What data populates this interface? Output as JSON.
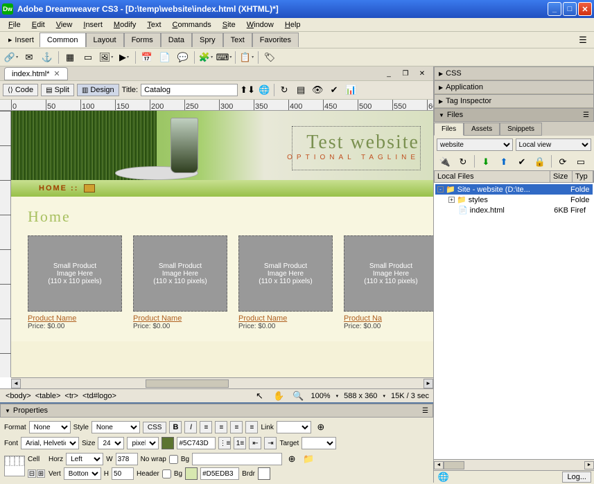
{
  "window": {
    "title": "Adobe Dreamweaver CS3 - [D:\\temp\\website\\index.html (XHTML)*]",
    "app_icon": "Dw"
  },
  "menu": [
    "File",
    "Edit",
    "View",
    "Insert",
    "Modify",
    "Text",
    "Commands",
    "Site",
    "Window",
    "Help"
  ],
  "insert_bar": {
    "label": "Insert",
    "tabs": [
      "Common",
      "Layout",
      "Forms",
      "Data",
      "Spry",
      "Text",
      "Favorites"
    ],
    "active": "Common"
  },
  "doc_tab": {
    "name": "index.html*"
  },
  "view_toolbar": {
    "code": "Code",
    "split": "Split",
    "design": "Design",
    "title_label": "Title:",
    "title_value": "Catalog"
  },
  "canvas": {
    "site_title": "Test website",
    "tagline": "OPTIONAL TAGLINE",
    "nav_home": "HOME ::",
    "page_heading": "Home",
    "placeholder_text": "Small Product\nImage Here\n(110 x 110 pixels)",
    "products": [
      {
        "name": "Product Name",
        "price": "Price: $0.00"
      },
      {
        "name": "Product Name",
        "price": "Price: $0.00"
      },
      {
        "name": "Product Name",
        "price": "Price: $0.00"
      },
      {
        "name": "Product Na",
        "price": "Price: $0.00"
      }
    ]
  },
  "status": {
    "tags": [
      "<body>",
      "<table>",
      "<tr>",
      "<td#logo>"
    ],
    "zoom": "100%",
    "dims": "588 x 360",
    "kb": "15K / 3 sec"
  },
  "properties": {
    "header": "Properties",
    "format_label": "Format",
    "format_value": "None",
    "style_label": "Style",
    "style_value": "None",
    "css_btn": "CSS",
    "link_label": "Link",
    "font_label": "Font",
    "font_value": "Arial, Helvetica",
    "size_label": "Size",
    "size_value": "24",
    "size_unit": "pixels",
    "color_value": "#5C743D",
    "target_label": "Target",
    "cell_label": "Cell",
    "horz_label": "Horz",
    "horz_value": "Left",
    "w_label": "W",
    "w_value": "378",
    "nowrap_label": "No wrap",
    "bg_label": "Bg",
    "vert_label": "Vert",
    "vert_value": "Bottom",
    "h_label": "H",
    "h_value": "50",
    "header_label": "Header",
    "bg2_label": "Bg",
    "bg2_value": "#D5EDB3",
    "brdr_label": "Brdr"
  },
  "right_panels": {
    "css": "CSS",
    "application": "Application",
    "tag_inspector": "Tag Inspector",
    "files": "Files",
    "files_tabs": [
      "Files",
      "Assets",
      "Snippets"
    ],
    "site_dd": "website",
    "view_dd": "Local view",
    "cols": {
      "local": "Local Files",
      "size": "Size",
      "type": "Typ"
    },
    "tree": [
      {
        "level": 0,
        "exp": "-",
        "icon": "folder",
        "name": "Site - website (D:\\te...",
        "size": "",
        "type": "Folde"
      },
      {
        "level": 1,
        "exp": "+",
        "icon": "folder",
        "name": "styles",
        "size": "",
        "type": "Folde"
      },
      {
        "level": 1,
        "exp": "",
        "icon": "file",
        "name": "index.html",
        "size": "6KB",
        "type": "Firef"
      }
    ],
    "log_btn": "Log..."
  }
}
